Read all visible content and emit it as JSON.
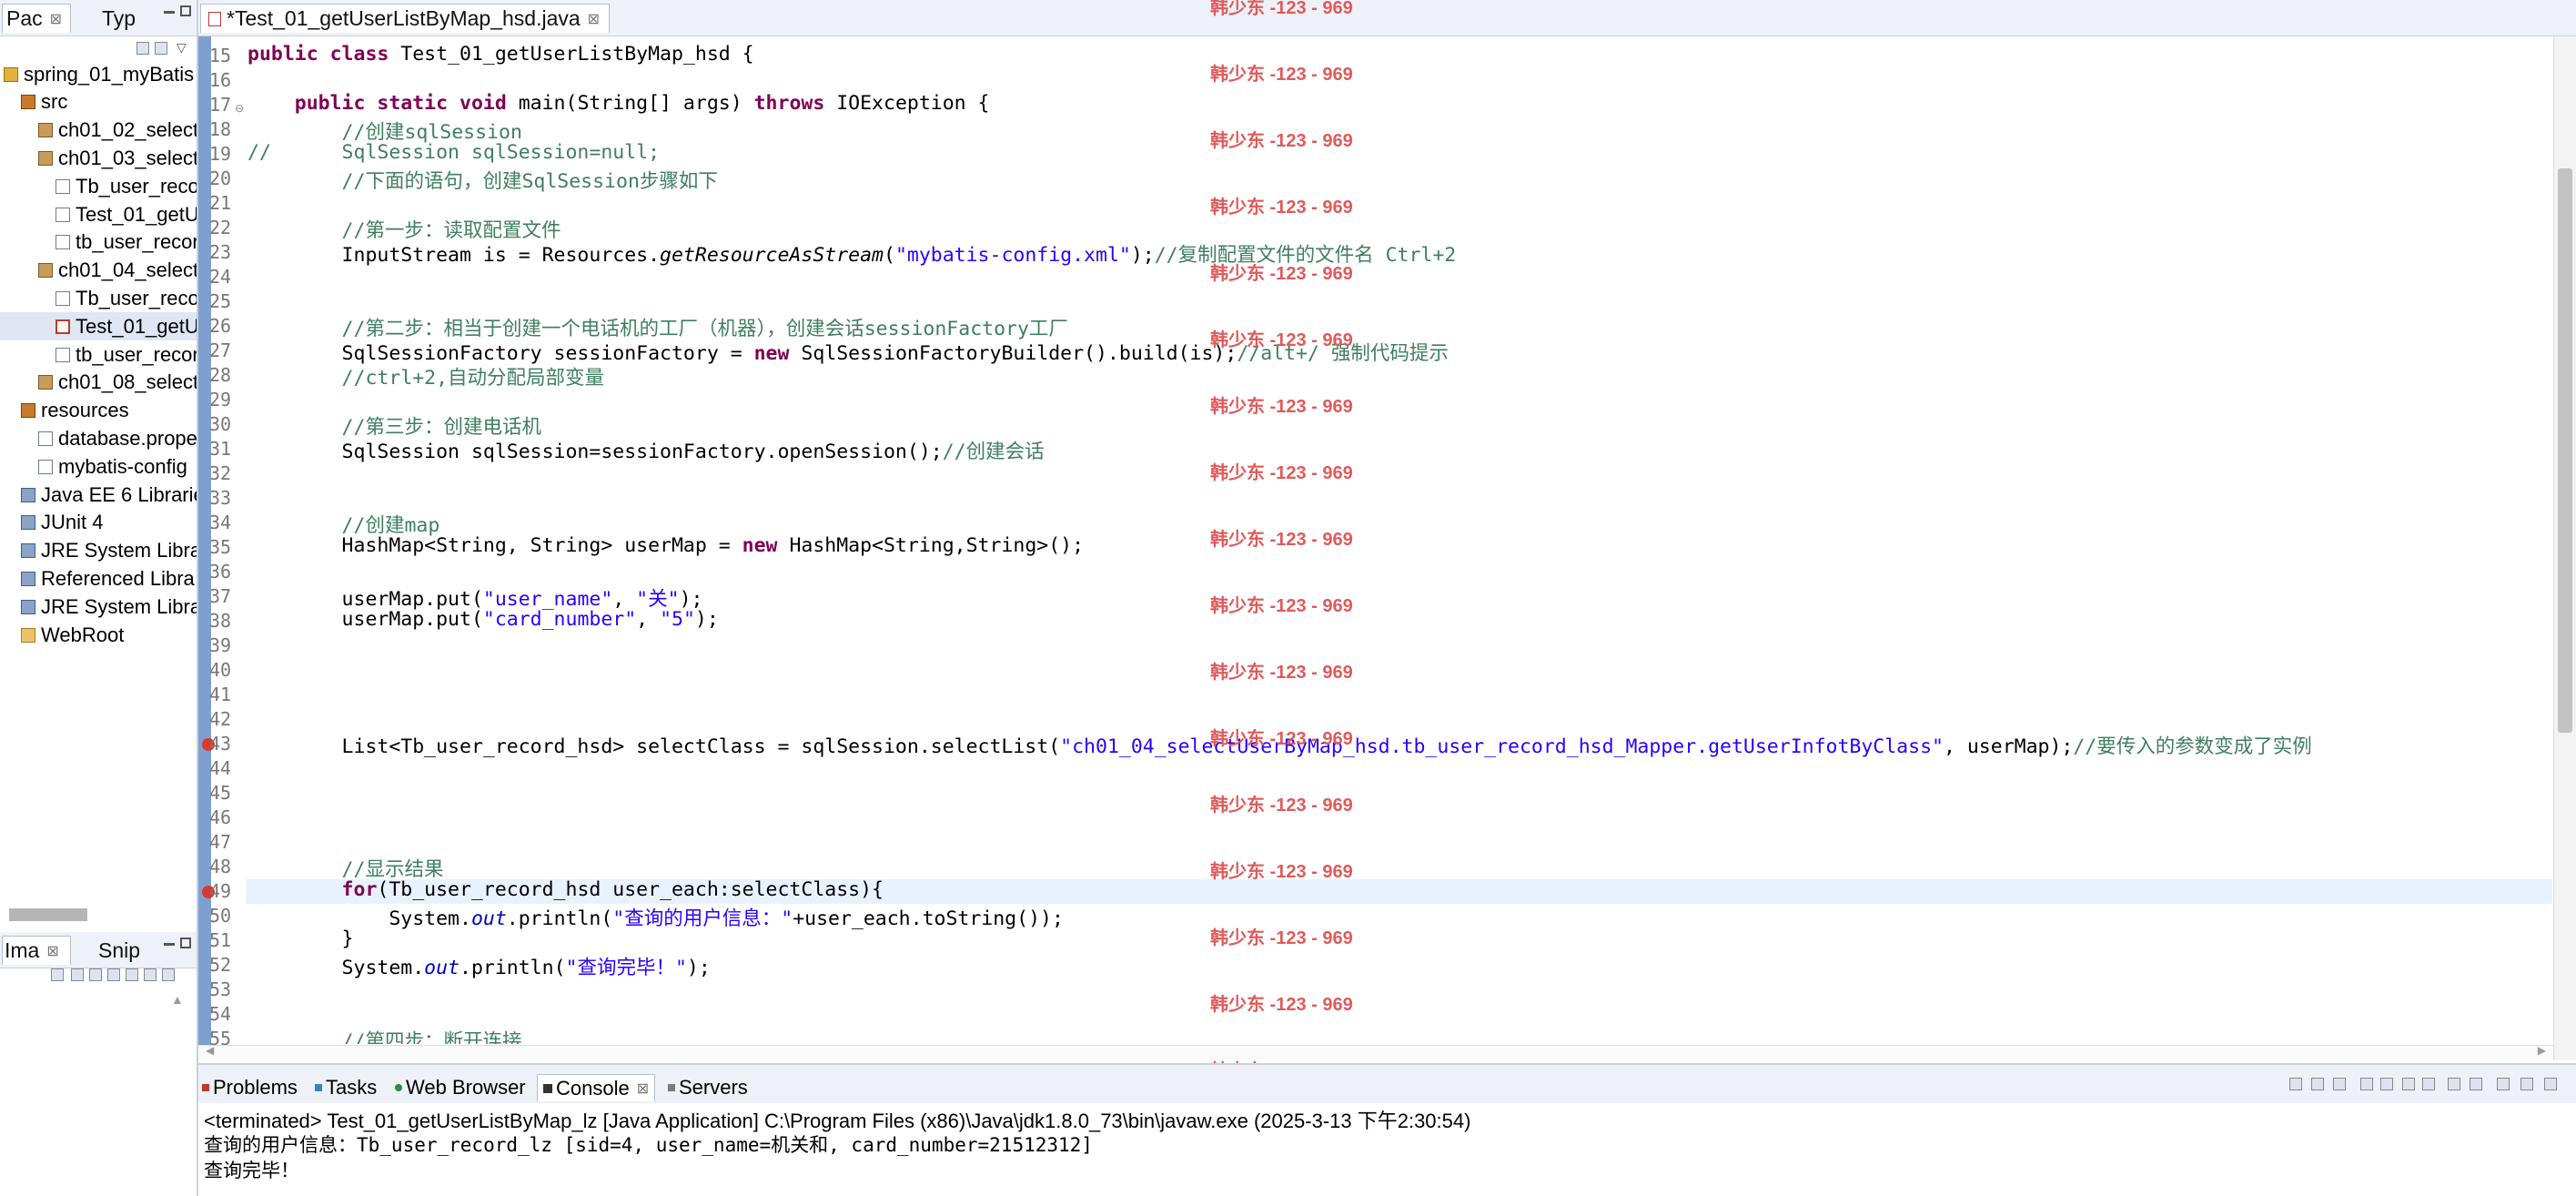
{
  "package_explorer": {
    "tabs": [
      {
        "label": "Pac",
        "close": "⊠"
      },
      {
        "label": "Typ",
        "close": ""
      }
    ],
    "tree": [
      {
        "label": "spring_01_myBatis",
        "icon": "project-icon",
        "indent": 0
      },
      {
        "label": "src",
        "icon": "source-folder-icon",
        "indent": 1
      },
      {
        "label": "ch01_02_select",
        "icon": "package-icon",
        "indent": 2
      },
      {
        "label": "ch01_03_select",
        "icon": "package-icon",
        "indent": 2
      },
      {
        "label": "Tb_user_reco",
        "icon": "java-file-icon",
        "indent": 3
      },
      {
        "label": "Test_01_getU",
        "icon": "java-file-icon",
        "indent": 3
      },
      {
        "label": "tb_user_recor",
        "icon": "xml-file-icon",
        "indent": 3
      },
      {
        "label": "ch01_04_select",
        "icon": "package-error-icon",
        "indent": 2
      },
      {
        "label": "Tb_user_reco",
        "icon": "java-file-icon",
        "indent": 3
      },
      {
        "label": "Test_01_getU",
        "icon": "java-file-error-icon",
        "indent": 3,
        "selected": true
      },
      {
        "label": "tb_user_recor",
        "icon": "xml-file-icon",
        "indent": 3
      },
      {
        "label": "ch01_08_select",
        "icon": "package-icon",
        "indent": 2
      },
      {
        "label": "resources",
        "icon": "source-folder-icon",
        "indent": 1
      },
      {
        "label": "database.prope",
        "icon": "properties-file-icon",
        "indent": 2
      },
      {
        "label": "mybatis-config",
        "icon": "xml-file-icon",
        "indent": 2
      },
      {
        "label": "Java EE 6 Librarie",
        "icon": "library-icon",
        "indent": 1
      },
      {
        "label": "JUnit 4",
        "icon": "library-icon",
        "indent": 1
      },
      {
        "label": "JRE System Libra",
        "icon": "library-icon",
        "indent": 1
      },
      {
        "label": "Referenced Libra",
        "icon": "library-icon",
        "indent": 1
      },
      {
        "label": "JRE System Libra",
        "icon": "library-icon",
        "indent": 1
      },
      {
        "label": "WebRoot",
        "icon": "folder-icon",
        "indent": 1
      }
    ]
  },
  "image_panel": {
    "tabs": [
      {
        "label": "Ima",
        "close": "⊠"
      },
      {
        "label": "Snip",
        "close": ""
      }
    ]
  },
  "editor": {
    "tab_label": "*Test_01_getUserListByMap_hsd.java",
    "tab_close": "⊠",
    "watermark": "韩少东 -123 - 969",
    "line_numbers": [
      "15",
      "16",
      "17",
      "18",
      "19",
      "20",
      "21",
      "22",
      "23",
      "24",
      "25",
      "26",
      "27",
      "28",
      "29",
      "30",
      "31",
      "32",
      "33",
      "34",
      "35",
      "36",
      "37",
      "38",
      "39",
      "40",
      "41",
      "42",
      "43",
      "44",
      "45",
      "46",
      "47",
      "48",
      "49",
      "50",
      "51",
      "52",
      "53",
      "54",
      "55"
    ],
    "lines": {
      "l15_a": "public class ",
      "l15_b": "Test_01_getUserListByMap_hsd {",
      "l17_a": "    public static void ",
      "l17_b": "main(String[] args) ",
      "l17_c": "throws ",
      "l17_d": "IOException {",
      "l18": "        //创建sqlSession",
      "l19": "//      SqlSession sqlSession=null;",
      "l20": "        //下面的语句，创建SqlSession步骤如下",
      "l22": "        //第一步：读取配置文件",
      "l23_a": "        InputStream is = Resources.",
      "l23_b": "getResourceAsStream",
      "l23_c": "(",
      "l23_d": "\"mybatis-config.xml\"",
      "l23_e": ");",
      "l23_f": "//复制配置文件的文件名 Ctrl+2",
      "l26": "        //第二步：相当于创建一个电话机的工厂（机器），创建会话sessionFactory工厂",
      "l27_a": "        SqlSessionFactory sessionFactory = ",
      "l27_b": "new ",
      "l27_c": "SqlSessionFactoryBuilder().build(is);",
      "l27_d": "//alt+/ 强制代码提示",
      "l28": "        //ctrl+2,自动分配局部变量",
      "l30": "        //第三步：创建电话机",
      "l31_a": "        SqlSession sqlSession=sessionFactory.openSession();",
      "l31_b": "//创建会话",
      "l34": "        //创建map",
      "l35_a": "        HashMap<String, String> userMap = ",
      "l35_b": "new ",
      "l35_c": "HashMap<String,String>();",
      "l37_a": "        userMap.put(",
      "l37_b": "\"user_name\"",
      "l37_c": ", ",
      "l37_d": "\"关\"",
      "l37_e": ");",
      "l38_a": "        userMap.put(",
      "l38_b": "\"card_number\"",
      "l38_c": ", ",
      "l38_d": "\"5\"",
      "l38_e": ");",
      "l43_a": "        List<Tb_user_record_hsd> selectClass = sqlSession.selectList(",
      "l43_b": "\"ch01_04_selectUserByMap_hsd.tb_user_record_hsd_Mapper.getUserInfotByClass\"",
      "l43_c": ", userMap);",
      "l43_d": "//要传入的参数变成了实例",
      "l48": "        //显示结果",
      "l49_a": "        for",
      "l49_b": "(Tb_user_record_hsd user_each:selectClass){",
      "l50_a": "            System.",
      "l50_b": "out",
      "l50_c": ".println(",
      "l50_d": "\"查询的用户信息：\"",
      "l50_e": "+user_each.toString());",
      "l51": "        }",
      "l52_a": "        System.",
      "l52_b": "out",
      "l52_c": ".println(",
      "l52_d": "\"查询完毕！\"",
      "l52_e": ");",
      "l55": "        //第四步：断开连接"
    }
  },
  "bottom_panel": {
    "tabs": [
      {
        "label": "Problems",
        "icon": "problems-icon"
      },
      {
        "label": "Tasks",
        "icon": "tasks-icon"
      },
      {
        "label": "Web Browser",
        "icon": "browser-icon"
      },
      {
        "label": "Console",
        "icon": "console-icon",
        "active": true,
        "close": "⊠"
      },
      {
        "label": "Servers",
        "icon": "servers-icon"
      }
    ],
    "console_header": "<terminated> Test_01_getUserListByMap_lz [Java Application] C:\\Program Files (x86)\\Java\\jdk1.8.0_73\\bin\\javaw.exe (2025-3-13 下午2:30:54)",
    "console_lines": [
      "查询的用户信息：Tb_user_record_lz [sid=4, user_name=机关和, card_number=21512312]",
      "查询完毕！"
    ]
  },
  "colors": {
    "keyword": "#7f0055",
    "string": "#2a00ff",
    "comment": "#3f7f5f",
    "watermark": "#e05a5a",
    "current_line": "#e8f2fe"
  }
}
